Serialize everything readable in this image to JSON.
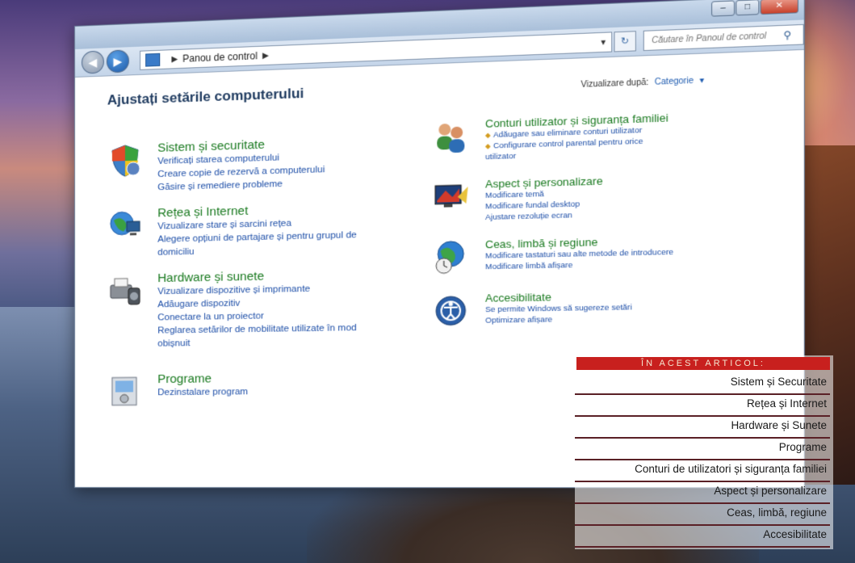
{
  "window": {
    "breadcrumb": "Panou de control",
    "search_placeholder": "Căutare în Panoul de control",
    "title": "Ajustați setările computerului",
    "view_by_label": "Vizualizare după:",
    "view_by_value": "Categorie"
  },
  "categories_left": [
    {
      "title": "Sistem și securitate",
      "icon": "shield-icon",
      "links": [
        "Verificați starea computerului",
        "Creare copie de rezervă a computerului",
        "Găsire și remediere probleme"
      ]
    },
    {
      "title": "Rețea și Internet",
      "icon": "network-icon",
      "links": [
        "Vizualizare stare și sarcini rețea",
        "Alegere opțiuni de partajare și pentru grupul de domiciliu"
      ]
    },
    {
      "title": "Hardware și sunete",
      "icon": "printer-icon",
      "links": [
        "Vizualizare dispozitive și imprimante",
        "Adăugare dispozitiv",
        "Conectare la un proiector",
        "Reglarea setărilor de mobilitate utilizate în mod obișnuit"
      ]
    },
    {
      "title": "Programe",
      "icon": "programs-icon",
      "links": [
        "Dezinstalare program"
      ]
    }
  ],
  "categories_right": [
    {
      "title": "Conturi utilizator și siguranța familiei",
      "icon": "users-icon",
      "links": [
        "Adăugare sau eliminare conturi utilizator",
        "Configurare control parental pentru orice utilizator"
      ]
    },
    {
      "title": "Aspect și personalizare",
      "icon": "display-icon",
      "links": [
        "Modificare temă",
        "Modificare fundal desktop",
        "Ajustare rezoluție ecran"
      ]
    },
    {
      "title": "Ceas, limbă și regiune",
      "icon": "globe-clock-icon",
      "links": [
        "Modificare tastaturi sau alte metode de introducere",
        "Modificare limbă afișare"
      ]
    },
    {
      "title": "Accesibilitate",
      "icon": "accessibility-icon",
      "links": [
        "Se permite Windows să sugereze setări",
        "Optimizare afișare"
      ]
    }
  ],
  "article": {
    "heading": "ÎN ACEST ARTICOL:",
    "items": [
      "Sistem și Securitate",
      "Rețea și Internet",
      "Hardware și Sunete",
      "Programe",
      "Conturi de utilizatori și siguranța familiei",
      "Aspect și personalizare",
      "Ceas, limbă, regiune",
      "Accesibilitate"
    ]
  }
}
